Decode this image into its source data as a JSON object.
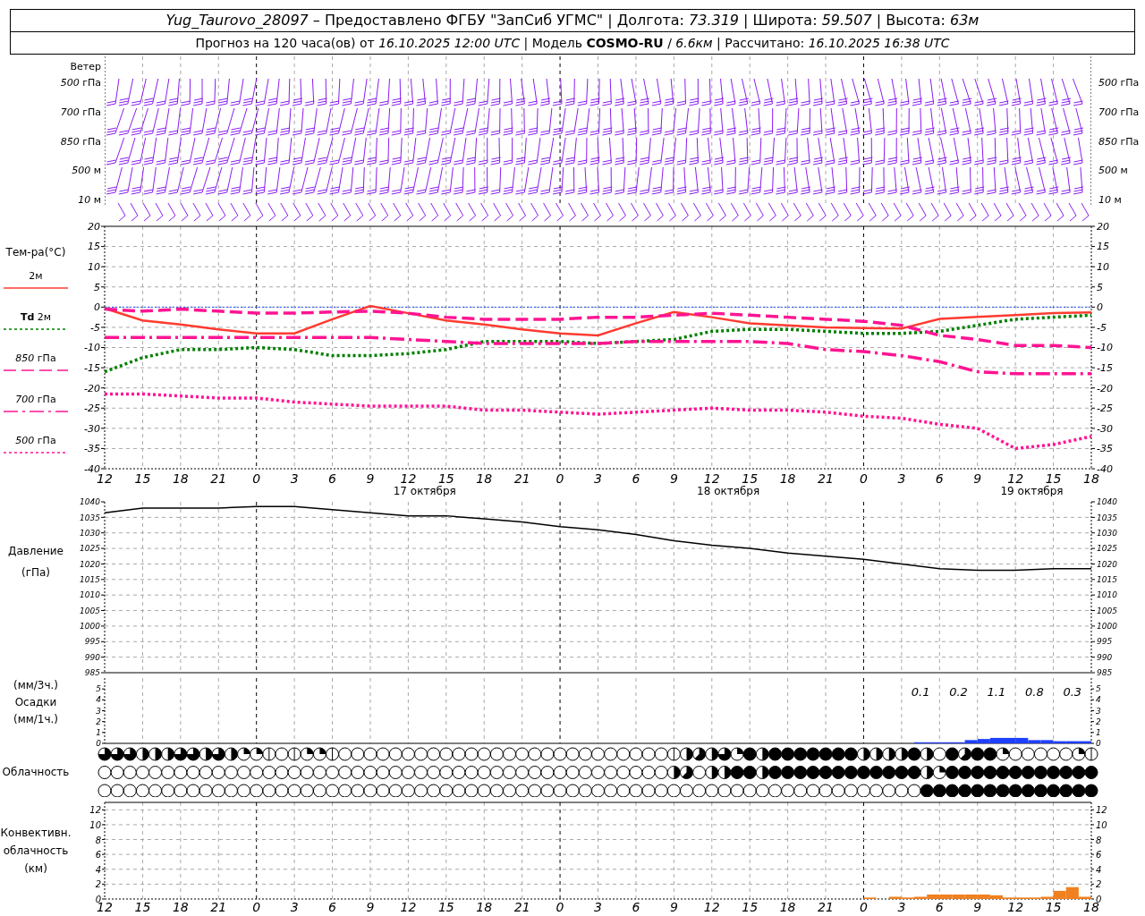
{
  "header": {
    "line_1": "*Yug_Taurovo_28097* – Предоставлено ФГБУ \"ЗапСиб УГМС\" | Долгота: *73.319* | Широта: *59.507* | Высота: *63м*",
    "line_2": "Прогноз на 120 часа(ов) от *16.10.2025 12:00 UTC* | Модель **COSMO-RU** / *6.6км* | Рассчитано: *16.10.2025 16:38 UTC*"
  },
  "wind": {
    "title": "Ветер",
    "levels_left": [
      "*500* гПа",
      "*700* гПа",
      "*850* гПа",
      "*500* м",
      "*10* м"
    ],
    "levels_right": [
      "*500* гПа",
      "*700* гПа",
      "*850* гПа",
      "*500* м",
      "*10* м"
    ]
  },
  "temperature": {
    "title": "Тем-ра(°C)",
    "legend": [
      "2м",
      "**Td** 2м",
      "*850* гПа",
      "*700* гПа",
      "*500* гПа"
    ],
    "chart_data": {
      "type": "line",
      "categories": [
        "12",
        "15",
        "18",
        "21",
        "0",
        "3",
        "6",
        "9",
        "12",
        "15",
        "18",
        "21",
        "0",
        "3",
        "6",
        "9",
        "12",
        "15",
        "18",
        "21",
        "0",
        "3",
        "6",
        "9",
        "12",
        "15",
        "18"
      ],
      "ylim": [
        -40,
        20
      ],
      "grid": true,
      "ref_lines": [
        {
          "axis": "y",
          "value": 0,
          "color": "#2050ff"
        }
      ],
      "yticks": [
        20,
        15,
        10,
        5,
        0,
        -5,
        -10,
        -15,
        -20,
        -25,
        -30,
        -35,
        -40
      ],
      "series": [
        {
          "color": "#ff3b30",
          "line_style": "solid",
          "values": [
            -0.3,
            -3.3,
            -4.3,
            -5.5,
            -6.5,
            -6.5,
            -3,
            0.3,
            -1.5,
            -3.3,
            -4.3,
            -5.5,
            -6.5,
            -7,
            -4,
            -1.2,
            -2.5,
            -4,
            -4.5,
            -5,
            -5.2,
            -5.3,
            -2.9,
            -2.4,
            -2,
            -1.5,
            -1.3
          ]
        },
        {
          "color": "#008000",
          "line_style": "dotted",
          "values": [
            -16,
            -12.5,
            -10.5,
            -10.5,
            -10,
            -10.5,
            -12,
            -12,
            -11.5,
            -10.5,
            -8.5,
            -8.5,
            -8.5,
            -9,
            -8.5,
            -8,
            -6,
            -5.5,
            -5.5,
            -6,
            -6.5,
            -6.5,
            -6,
            -4.5,
            -3,
            -2.5,
            -2
          ]
        },
        {
          "color": "#ff1493",
          "line_style": "dashed",
          "values": [
            -0.5,
            -1,
            -0.5,
            -1,
            -1.5,
            -1.5,
            -1.2,
            -1,
            -1.5,
            -2.5,
            -3,
            -3,
            -3,
            -2.5,
            -2.5,
            -2,
            -1.5,
            -2,
            -2.5,
            -3,
            -3.5,
            -4.5,
            -7,
            -8,
            -9.5,
            -9.5,
            -10
          ]
        },
        {
          "color": "#ff1493",
          "line_style": "dashdot",
          "values": [
            -7.5,
            -7.5,
            -7.5,
            -7.5,
            -7.5,
            -7.5,
            -7.5,
            -7.5,
            -8,
            -8.5,
            -9,
            -9,
            -9,
            -9,
            -8.5,
            -8.5,
            -8.5,
            -8.5,
            -9,
            -10.5,
            -11,
            -12,
            -13.5,
            -16,
            -16.5,
            -16.5,
            -16.5
          ]
        },
        {
          "color": "#ff1493",
          "line_style": "dotted",
          "values": [
            -21.5,
            -21.5,
            -22,
            -22.5,
            -22.5,
            -23.5,
            -24,
            -24.5,
            -24.5,
            -24.5,
            -25.5,
            -25.5,
            -26,
            -26.5,
            -26,
            -25.5,
            -25,
            -25.5,
            -25.5,
            -26,
            -27,
            -27.5,
            -29,
            -30,
            -35,
            -34,
            -32
          ]
        }
      ]
    },
    "right_axis": [
      "20",
      "15",
      "10",
      "5",
      "0",
      "-5",
      "-10",
      "-15",
      "-20",
      "-25",
      "-30",
      "-35",
      "-40"
    ],
    "dates": [
      "17 октября",
      "18 октября",
      "19 октября"
    ]
  },
  "pressure": {
    "title": "Давление",
    "unit": "(гПа)",
    "chart_data": {
      "type": "line",
      "grid": true,
      "ylim": [
        985,
        1040
      ],
      "yticks": [
        1040,
        1035,
        1030,
        1025,
        1020,
        1015,
        1010,
        1005,
        1000,
        995,
        990,
        985
      ],
      "series": [
        {
          "color": "#000000",
          "values": [
            1036.5,
            1038,
            1038,
            1038,
            1038.5,
            1038.5,
            1037.5,
            1036.5,
            1035.5,
            1035.5,
            1034.5,
            1033.5,
            1032,
            1031,
            1029.5,
            1027.5,
            1026,
            1025,
            1023.5,
            1022.5,
            1021.5,
            1020,
            1018.5,
            1018,
            1018,
            1018.5,
            1018.5
          ]
        }
      ]
    },
    "right_axis": [
      "1040",
      "1035",
      "1030",
      "1025",
      "1020",
      "1015",
      "1010",
      "1005",
      "1000",
      "995",
      "990",
      "985"
    ]
  },
  "precipitation": {
    "unit_top": "(мм/3ч.)",
    "title": "Осадки",
    "unit_bottom": "(мм/1ч.)",
    "chart_data": {
      "type": "bar",
      "grid": true,
      "ylim": [
        0,
        6
      ],
      "yticks": [
        5,
        4,
        3,
        2,
        1,
        0
      ],
      "color": "#1f3fff",
      "values": [
        null,
        null,
        null,
        null,
        null,
        null,
        null,
        null,
        null,
        null,
        null,
        null,
        null,
        null,
        null,
        null,
        null,
        null,
        null,
        null,
        null,
        null,
        null,
        null,
        null,
        null,
        null,
        null,
        null,
        null,
        null,
        null,
        null,
        null,
        null,
        null,
        null,
        null,
        null,
        null,
        null,
        null,
        null,
        null,
        null,
        null,
        null,
        null,
        null,
        null,
        null,
        null,
        null,
        null,
        null,
        null,
        null,
        null,
        null,
        null,
        null,
        null,
        null,
        null,
        null,
        0.1,
        0.1,
        0.1,
        0.1,
        0.3,
        0.4,
        0.5,
        0.5,
        0.5,
        0.3,
        0.3,
        0.2,
        0.2,
        0.2
      ],
      "annotations": [
        "0.1",
        "0.2",
        "1.1",
        "0.8",
        "0.3"
      ]
    },
    "right_axis": [
      "5",
      "4",
      "3",
      "2",
      "1",
      "0"
    ]
  },
  "clouds": {
    "title": "Облачность",
    "rows": [
      {
        "cells": [
          {
            "kind": "three"
          },
          {
            "kind": "three"
          },
          {
            "kind": "three"
          },
          {
            "kind": "half"
          },
          {
            "kind": "half"
          },
          {
            "kind": "half"
          },
          {
            "kind": "three"
          },
          {
            "kind": "three"
          },
          {
            "kind": "half"
          },
          {
            "kind": "three"
          },
          {
            "kind": "half"
          },
          {
            "kind": "quarter"
          },
          {
            "kind": "quarter"
          },
          {
            "kind": "trace"
          },
          {
            "kind": "clear"
          },
          {
            "kind": "trace"
          },
          {
            "kind": "quarter"
          },
          {
            "kind": "quarter"
          },
          {
            "kind": "trace"
          },
          {
            "kind": "clear"
          },
          {
            "kind": "clear"
          },
          {
            "kind": "clear"
          },
          {
            "kind": "clear"
          },
          {
            "kind": "clear"
          },
          {
            "kind": "clear"
          },
          {
            "kind": "clear"
          },
          {
            "kind": "clear"
          },
          {
            "kind": "clear"
          },
          {
            "kind": "clear"
          },
          {
            "kind": "clear"
          },
          {
            "kind": "clear"
          },
          {
            "kind": "clear"
          },
          {
            "kind": "clear"
          },
          {
            "kind": "clear"
          },
          {
            "kind": "clear"
          },
          {
            "kind": "clear"
          },
          {
            "kind": "clear"
          },
          {
            "kind": "clear"
          },
          {
            "kind": "clear"
          },
          {
            "kind": "clear"
          },
          {
            "kind": "clear"
          },
          {
            "kind": "clear"
          },
          {
            "kind": "clear"
          },
          {
            "kind": "clear"
          },
          {
            "kind": "clear"
          },
          {
            "kind": "trace"
          },
          {
            "kind": "half"
          },
          {
            "kind": "most"
          },
          {
            "kind": "half"
          },
          {
            "kind": "three"
          },
          {
            "kind": "quarter"
          },
          {
            "kind": "full"
          },
          {
            "kind": "half"
          },
          {
            "kind": "full"
          },
          {
            "kind": "full"
          },
          {
            "kind": "full"
          },
          {
            "kind": "full"
          },
          {
            "kind": "full"
          },
          {
            "kind": "full"
          },
          {
            "kind": "full"
          },
          {
            "kind": "half"
          },
          {
            "kind": "half"
          },
          {
            "kind": "half"
          },
          {
            "kind": "half"
          },
          {
            "kind": "full"
          },
          {
            "kind": "half"
          },
          {
            "kind": "clear"
          },
          {
            "kind": "full"
          },
          {
            "kind": "most"
          },
          {
            "kind": "full"
          },
          {
            "kind": "full"
          },
          {
            "kind": "quarter"
          },
          {
            "kind": "clear"
          },
          {
            "kind": "clear"
          },
          {
            "kind": "clear"
          },
          {
            "kind": "clear"
          },
          {
            "kind": "clear"
          },
          {
            "kind": "quarter"
          },
          {
            "kind": "trace"
          }
        ]
      },
      {
        "cells": [
          {
            "kind": "clear"
          },
          {
            "kind": "clear"
          },
          {
            "kind": "clear"
          },
          {
            "kind": "clear"
          },
          {
            "kind": "clear"
          },
          {
            "kind": "clear"
          },
          {
            "kind": "clear"
          },
          {
            "kind": "clear"
          },
          {
            "kind": "clear"
          },
          {
            "kind": "clear"
          },
          {
            "kind": "clear"
          },
          {
            "kind": "clear"
          },
          {
            "kind": "clear"
          },
          {
            "kind": "clear"
          },
          {
            "kind": "clear"
          },
          {
            "kind": "clear"
          },
          {
            "kind": "clear"
          },
          {
            "kind": "clear"
          },
          {
            "kind": "clear"
          },
          {
            "kind": "clear"
          },
          {
            "kind": "clear"
          },
          {
            "kind": "clear"
          },
          {
            "kind": "clear"
          },
          {
            "kind": "clear"
          },
          {
            "kind": "clear"
          },
          {
            "kind": "clear"
          },
          {
            "kind": "clear"
          },
          {
            "kind": "clear"
          },
          {
            "kind": "clear"
          },
          {
            "kind": "clear"
          },
          {
            "kind": "clear"
          },
          {
            "kind": "clear"
          },
          {
            "kind": "clear"
          },
          {
            "kind": "clear"
          },
          {
            "kind": "clear"
          },
          {
            "kind": "clear"
          },
          {
            "kind": "clear"
          },
          {
            "kind": "clear"
          },
          {
            "kind": "clear"
          },
          {
            "kind": "clear"
          },
          {
            "kind": "clear"
          },
          {
            "kind": "clear"
          },
          {
            "kind": "clear"
          },
          {
            "kind": "clear"
          },
          {
            "kind": "clear"
          },
          {
            "kind": "half"
          },
          {
            "kind": "most"
          },
          {
            "kind": "clear"
          },
          {
            "kind": "half"
          },
          {
            "kind": "half"
          },
          {
            "kind": "full"
          },
          {
            "kind": "full"
          },
          {
            "kind": "half"
          },
          {
            "kind": "full"
          },
          {
            "kind": "full"
          },
          {
            "kind": "full"
          },
          {
            "kind": "full"
          },
          {
            "kind": "full"
          },
          {
            "kind": "full"
          },
          {
            "kind": "full"
          },
          {
            "kind": "full"
          },
          {
            "kind": "full"
          },
          {
            "kind": "full"
          },
          {
            "kind": "full"
          },
          {
            "kind": "full"
          },
          {
            "kind": "half"
          },
          {
            "kind": "quarter"
          },
          {
            "kind": "full"
          },
          {
            "kind": "full"
          },
          {
            "kind": "full"
          },
          {
            "kind": "full"
          },
          {
            "kind": "full"
          },
          {
            "kind": "full"
          },
          {
            "kind": "full"
          },
          {
            "kind": "full"
          },
          {
            "kind": "full"
          },
          {
            "kind": "full"
          },
          {
            "kind": "full"
          },
          {
            "kind": "full"
          }
        ]
      },
      {
        "cells": [
          {
            "kind": "clear"
          },
          {
            "kind": "clear"
          },
          {
            "kind": "clear"
          },
          {
            "kind": "clear"
          },
          {
            "kind": "clear"
          },
          {
            "kind": "clear"
          },
          {
            "kind": "clear"
          },
          {
            "kind": "clear"
          },
          {
            "kind": "clear"
          },
          {
            "kind": "clear"
          },
          {
            "kind": "clear"
          },
          {
            "kind": "clear"
          },
          {
            "kind": "clear"
          },
          {
            "kind": "clear"
          },
          {
            "kind": "clear"
          },
          {
            "kind": "clear"
          },
          {
            "kind": "clear"
          },
          {
            "kind": "clear"
          },
          {
            "kind": "clear"
          },
          {
            "kind": "clear"
          },
          {
            "kind": "clear"
          },
          {
            "kind": "clear"
          },
          {
            "kind": "clear"
          },
          {
            "kind": "clear"
          },
          {
            "kind": "clear"
          },
          {
            "kind": "clear"
          },
          {
            "kind": "clear"
          },
          {
            "kind": "clear"
          },
          {
            "kind": "clear"
          },
          {
            "kind": "clear"
          },
          {
            "kind": "clear"
          },
          {
            "kind": "clear"
          },
          {
            "kind": "clear"
          },
          {
            "kind": "clear"
          },
          {
            "kind": "clear"
          },
          {
            "kind": "clear"
          },
          {
            "kind": "clear"
          },
          {
            "kind": "clear"
          },
          {
            "kind": "clear"
          },
          {
            "kind": "clear"
          },
          {
            "kind": "clear"
          },
          {
            "kind": "clear"
          },
          {
            "kind": "clear"
          },
          {
            "kind": "clear"
          },
          {
            "kind": "clear"
          },
          {
            "kind": "clear"
          },
          {
            "kind": "clear"
          },
          {
            "kind": "clear"
          },
          {
            "kind": "clear"
          },
          {
            "kind": "clear"
          },
          {
            "kind": "clear"
          },
          {
            "kind": "clear"
          },
          {
            "kind": "clear"
          },
          {
            "kind": "clear"
          },
          {
            "kind": "clear"
          },
          {
            "kind": "clear"
          },
          {
            "kind": "clear"
          },
          {
            "kind": "clear"
          },
          {
            "kind": "clear"
          },
          {
            "kind": "clear"
          },
          {
            "kind": "clear"
          },
          {
            "kind": "clear"
          },
          {
            "kind": "clear"
          },
          {
            "kind": "clear"
          },
          {
            "kind": "clear"
          },
          {
            "kind": "full"
          },
          {
            "kind": "full"
          },
          {
            "kind": "full"
          },
          {
            "kind": "full"
          },
          {
            "kind": "full"
          },
          {
            "kind": "full"
          },
          {
            "kind": "full"
          },
          {
            "kind": "full"
          },
          {
            "kind": "full"
          },
          {
            "kind": "full"
          },
          {
            "kind": "full"
          },
          {
            "kind": "full"
          },
          {
            "kind": "full"
          },
          {
            "kind": "full"
          }
        ]
      }
    ]
  },
  "convective": {
    "title": "Конвективн.",
    "subtitle": "облачность",
    "unit": "(км)",
    "chart_data": {
      "type": "bar",
      "grid": true,
      "ylim": [
        0,
        13
      ],
      "yticks": [
        12,
        10,
        8,
        6,
        4,
        2,
        0
      ],
      "color": "#f08020",
      "values": [
        null,
        null,
        null,
        null,
        null,
        null,
        null,
        null,
        null,
        null,
        null,
        null,
        null,
        null,
        null,
        null,
        null,
        null,
        null,
        null,
        null,
        null,
        null,
        null,
        null,
        null,
        null,
        null,
        null,
        null,
        null,
        null,
        null,
        null,
        null,
        null,
        null,
        null,
        null,
        null,
        null,
        null,
        null,
        null,
        null,
        null,
        null,
        null,
        null,
        null,
        null,
        null,
        null,
        null,
        null,
        null,
        null,
        null,
        null,
        null,
        null,
        0.2,
        null,
        0.3,
        0.2,
        0.3,
        0.6,
        0.6,
        0.6,
        0.6,
        0.6,
        0.5,
        0.2,
        0.2,
        0.2,
        0.3,
        1.1,
        1.6,
        0.3
      ]
    },
    "right_axis": [
      "12",
      "10",
      "8",
      "6",
      "4",
      "2",
      "0"
    ],
    "time_axis": [
      "12",
      "15",
      "18",
      "21",
      "0",
      "3",
      "6",
      "9",
      "12",
      "15",
      "18",
      "21",
      "0",
      "3",
      "6",
      "9",
      "12",
      "15",
      "18",
      "21",
      "0",
      "3",
      "6",
      "9",
      "12",
      "15",
      "18"
    ]
  }
}
